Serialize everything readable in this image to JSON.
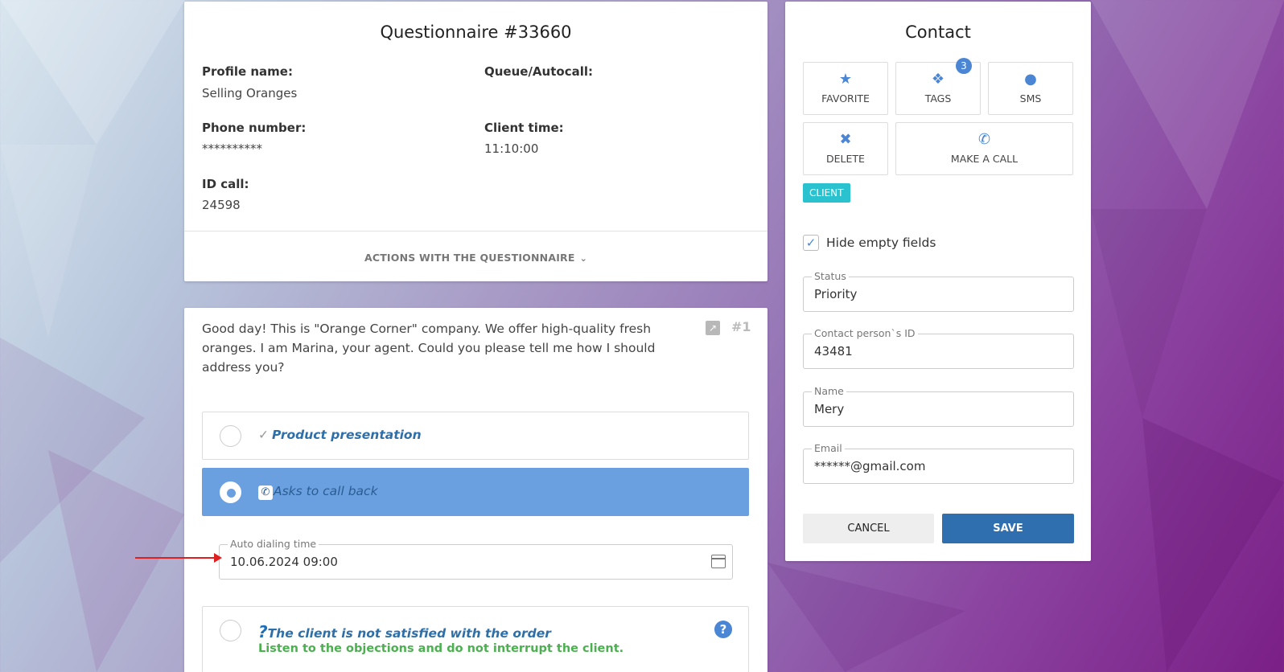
{
  "questionnaire": {
    "title": "Questionnaire #33660",
    "profile_label": "Profile name:",
    "profile_value": "Selling Oranges",
    "queue_label": "Queue/Autocall:",
    "queue_value": "",
    "phone_label": "Phone number:",
    "phone_value": "**********",
    "client_time_label": "Client time:",
    "client_time_value": "11:10:00",
    "id_call_label": "ID call:",
    "id_call_value": "24598",
    "actions_label": "ACTIONS WITH THE QUESTIONNAIRE"
  },
  "script": {
    "text": "Good day! This is \"Orange Corner\" company. We offer high-quality fresh oranges. I am Marina, your agent. Could you please tell me how I should address you?",
    "step_number": "#1",
    "options": [
      {
        "label": "Product presentation",
        "icon": "checkmark-icon",
        "selected": false
      },
      {
        "label": "Asks to call back",
        "icon": "phone-callback-icon",
        "selected": true
      },
      {
        "label": "The client is not satisfied with the order",
        "icon": "question-icon",
        "selected": false,
        "subtext": "Listen to the objections and do not interrupt the client."
      }
    ],
    "auto_dialing": {
      "label": "Auto dialing time",
      "value": "10.06.2024 09:00"
    }
  },
  "contact": {
    "title": "Contact",
    "buttons": {
      "favorite": "FAVORITE",
      "tags": "TAGS",
      "tags_count": "3",
      "sms": "SMS",
      "delete": "DELETE",
      "make_call": "MAKE A CALL"
    },
    "client_tag": "CLIENT",
    "hide_empty": {
      "label": "Hide empty fields",
      "checked": true
    },
    "fields": {
      "status": {
        "label": "Status",
        "value": "Priority"
      },
      "contact_id": {
        "label": "Contact person`s ID",
        "value": "43481"
      },
      "name": {
        "label": "Name",
        "value": "Mery"
      },
      "email": {
        "label": "Email",
        "value": "******@gmail.com"
      }
    },
    "cancel_label": "CANCEL",
    "save_label": "SAVE"
  },
  "colors": {
    "accent": "#4a86d3",
    "selected_option": "#6a9fe0",
    "save_button": "#2f6fb0",
    "client_tag": "#2bc2cf",
    "subtext_green": "#4cb050",
    "annotation_arrow": "#e02020"
  }
}
